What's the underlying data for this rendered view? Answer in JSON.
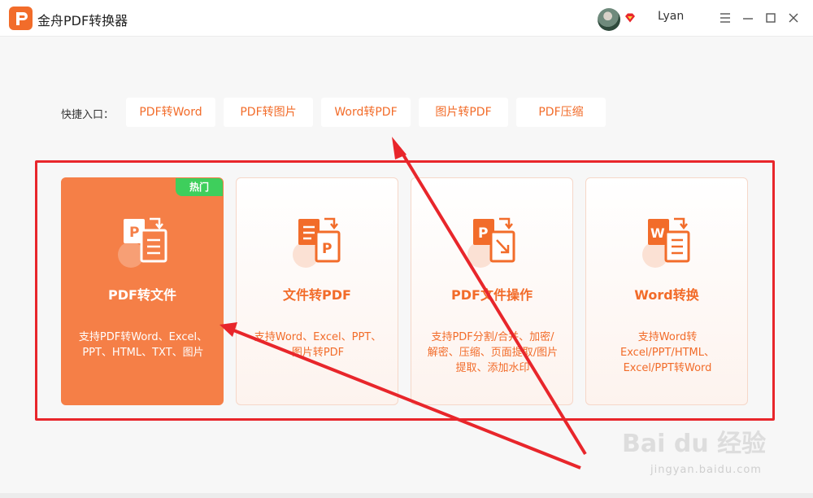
{
  "app": {
    "title": "金舟PDF转换器",
    "username": "Lyan",
    "accent_color": "#f26c2a"
  },
  "window_controls": [
    "menu-icon",
    "minimize-icon",
    "maximize-icon",
    "close-icon"
  ],
  "quick_entry": {
    "label": "快捷入口：",
    "buttons": [
      "PDF转Word",
      "PDF转图片",
      "Word转PDF",
      "图片转PDF",
      "PDF压缩"
    ]
  },
  "cards": [
    {
      "title": "PDF转文件",
      "desc": "支持PDF转Word、Excel、PPT、HTML、TXT、图片",
      "badge": "热门",
      "active": true,
      "icon": "pdf-to-file-icon"
    },
    {
      "title": "文件转PDF",
      "desc": "支持Word、Excel、PPT、图片转PDF",
      "active": false,
      "icon": "file-to-pdf-icon"
    },
    {
      "title": "PDF文件操作",
      "desc": "支持PDF分割/合并、加密/解密、压缩、页面提取/图片提取、添加水印",
      "active": false,
      "icon": "pdf-operation-icon"
    },
    {
      "title": "Word转换",
      "desc": "支持Word转Excel/PPT/HTML、Excel/PPT转Word",
      "active": false,
      "icon": "word-convert-icon"
    }
  ],
  "watermark": {
    "main": "Bai du 经验",
    "sub": "jingyan.baidu.com"
  },
  "colors": {
    "annotation_red": "#e8262b",
    "active_card": "#f57f47",
    "hot_badge": "#3ecf5c"
  }
}
